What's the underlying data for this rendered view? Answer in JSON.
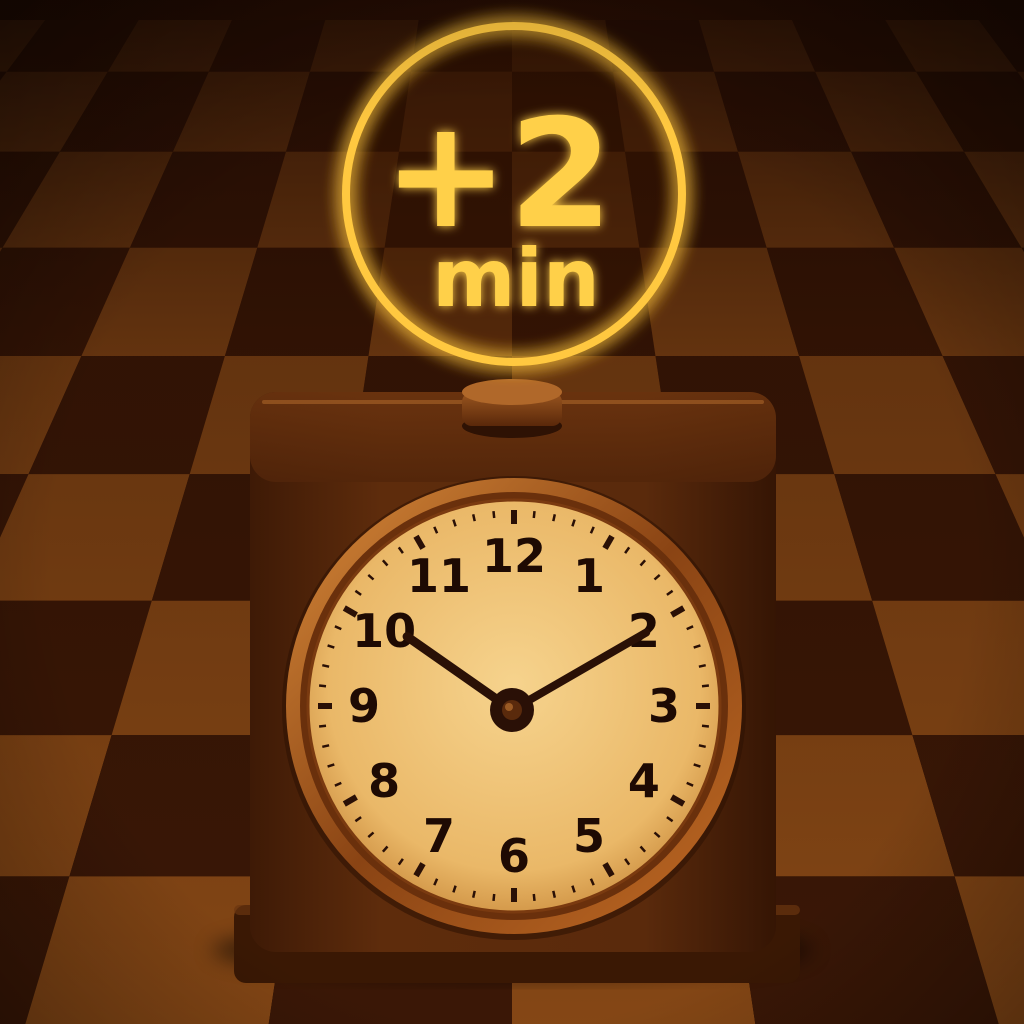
{
  "badge": {
    "value": "+2",
    "unit": "min",
    "glow_color": "#ffc840",
    "text_color": "#ffd04a"
  },
  "clock": {
    "dial_numbers": [
      "12",
      "1",
      "2",
      "3",
      "4",
      "5",
      "6",
      "7",
      "8",
      "9",
      "10",
      "11"
    ],
    "time_shown": "10:10",
    "hands_color": "#2a1006",
    "face_color": "#f0c47a",
    "body_color": "#5a2a0c"
  },
  "board": {
    "light_square": "#8a4a16",
    "dark_square": "#3c1806"
  }
}
